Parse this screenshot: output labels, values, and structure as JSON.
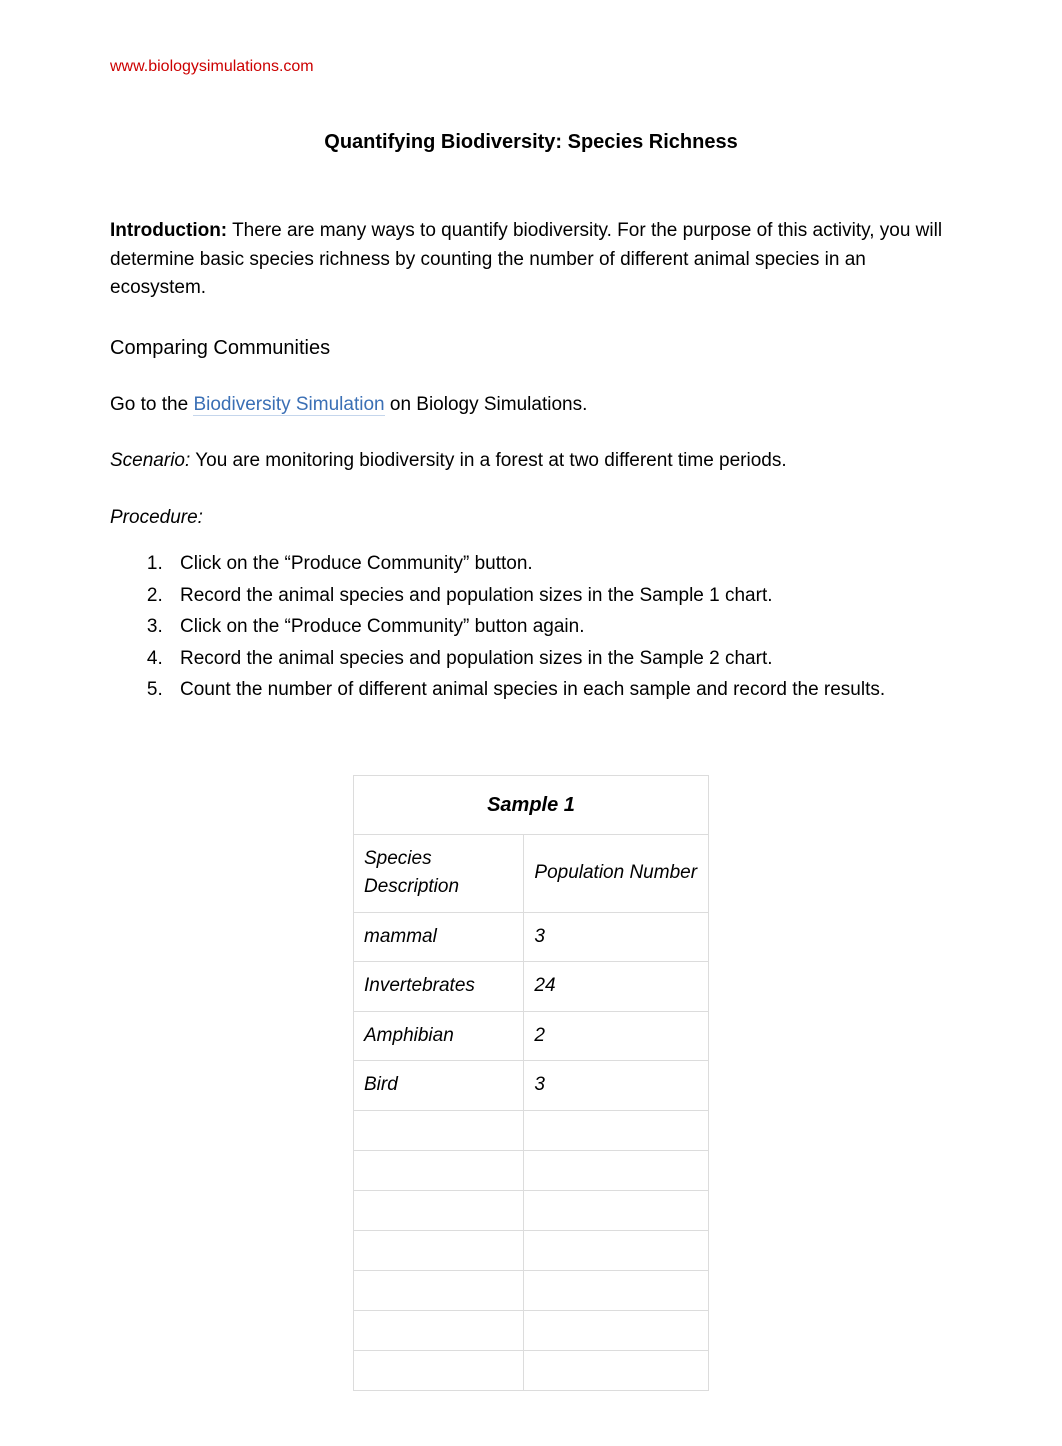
{
  "header": {
    "url": "www.biologysimulations.com"
  },
  "title": "Quantifying Biodiversity: Species Richness",
  "intro": {
    "label": "Introduction:",
    "text": " There are many ways to quantify biodiversity. For the purpose of this activity, you will determine basic species richness by counting the number of different animal species in an ecosystem."
  },
  "sectionHeading": "Comparing Communities",
  "goto": {
    "prefix": "Go to the ",
    "linkText": "Biodiversity Simulation",
    "suffix": " on Biology Simulations."
  },
  "scenario": {
    "label": "Scenario:",
    "text": " You are monitoring biodiversity in a forest at two different time periods."
  },
  "procedure": {
    "label": "Procedure:",
    "items": [
      "Click on the “Produce Community” button.",
      "Record the animal species and population sizes in the Sample 1 chart.",
      "Click on the “Produce Community” button again.",
      "Record the animal species and population sizes in the Sample 2 chart.",
      "Count the number of different animal species in each sample and record the results."
    ]
  },
  "table": {
    "title": "Sample 1",
    "headers": {
      "col1": "Species Description",
      "col2": "Population Number"
    },
    "rows": [
      {
        "species": "mammal",
        "population": "3"
      },
      {
        "species": "Invertebrates",
        "population": "24"
      },
      {
        "species": "Amphibian",
        "population": "2"
      },
      {
        "species": "Bird",
        "population": "3"
      }
    ],
    "blurredRows": [
      {
        "species": "",
        "population": ""
      },
      {
        "species": "",
        "population": ""
      },
      {
        "species": "",
        "population": ""
      },
      {
        "species": "",
        "population": ""
      },
      {
        "species": "",
        "population": ""
      },
      {
        "species": "",
        "population": ""
      },
      {
        "species": "",
        "population": ""
      }
    ]
  }
}
